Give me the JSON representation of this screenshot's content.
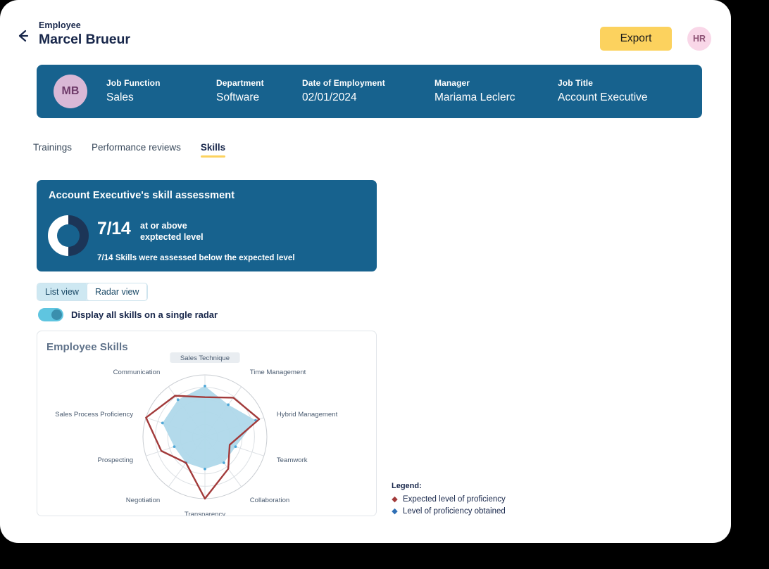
{
  "header": {
    "back_icon": "arrow-left-icon",
    "breadcrumb_label": "Employee",
    "page_title": "Marcel Brueur",
    "export_label": "Export",
    "user_avatar_initials": "HR",
    "accent_yellow": "#FCD25E",
    "avatar_bg": "#F9D7E8",
    "avatar_fg": "#8E5275"
  },
  "info_bar": {
    "avatar_initials": "MB",
    "bg_color": "#17628E",
    "avatar_bg": "#D9B8D6",
    "fields": [
      {
        "label": "Job Function",
        "value": "Sales"
      },
      {
        "label": "Department",
        "value": "Software"
      },
      {
        "label": "Date of Employment",
        "value": "02/01/2024"
      },
      {
        "label": "Manager",
        "value": "Mariama Leclerc"
      },
      {
        "label": "Job Title",
        "value": "Account Executive"
      }
    ]
  },
  "tabs": [
    {
      "label": "Trainings",
      "active": false
    },
    {
      "label": "Performance reviews",
      "active": false
    },
    {
      "label": "Skills",
      "active": true
    }
  ],
  "assessment": {
    "title": "Account Executive's skill assessment",
    "ratio": "7/14",
    "ratio_description": "at or above\nexptected level",
    "ratio_description_line1": "at or above",
    "ratio_description_line2": "exptected level",
    "note": "7/14 Skills were assessed below the expected level",
    "donut_percent": 50,
    "donut_filled_color": "#1C3557",
    "donut_track_color": "#ffffff"
  },
  "view_toggle": {
    "options": [
      {
        "label": "List view",
        "selected": false
      },
      {
        "label": "Radar view",
        "selected": true
      }
    ]
  },
  "single_radar_switch": {
    "label": "Display all skills on a single radar",
    "on": true,
    "track_color": "#5FC5E0",
    "knob_color": "#3A8FAD"
  },
  "radar_card": {
    "title": "Employee Skills",
    "highlighted_label": "Sales Technique"
  },
  "legend": {
    "title": "Legend:",
    "items": [
      {
        "marker": "diamond-icon",
        "color": "#A23A3A",
        "label": "Expected level of proficiency"
      },
      {
        "marker": "diamond-icon",
        "color": "#2E6FB5",
        "label": "Level of proficiency obtained"
      }
    ]
  },
  "chart_data": {
    "type": "radar",
    "title": "Employee Skills",
    "categories": [
      "Sales Technique",
      "Time Management",
      "Hybrid Management",
      "Teamwork",
      "Collaboration",
      "Transparency",
      "Negotiation",
      "Prospecting",
      "Sales Process Proficiency",
      "Communication"
    ],
    "rlim": [
      0,
      5
    ],
    "rings": 5,
    "grid": true,
    "legend_position": "right-outside",
    "series": [
      {
        "name": "Expected level of proficiency",
        "color": "#A23A3A",
        "fill": "none",
        "style": "line",
        "values": [
          3.2,
          3.9,
          4.6,
          2.1,
          3.2,
          5.0,
          2.6,
          3.7,
          5.0,
          4.1
        ]
      },
      {
        "name": "Level of proficiency obtained",
        "color": "#2E6FB5",
        "fill": "#AFD8EA",
        "style": "area",
        "values": [
          4.1,
          3.2,
          4.3,
          2.6,
          2.6,
          2.6,
          2.6,
          2.6,
          3.6,
          3.7
        ]
      }
    ]
  }
}
